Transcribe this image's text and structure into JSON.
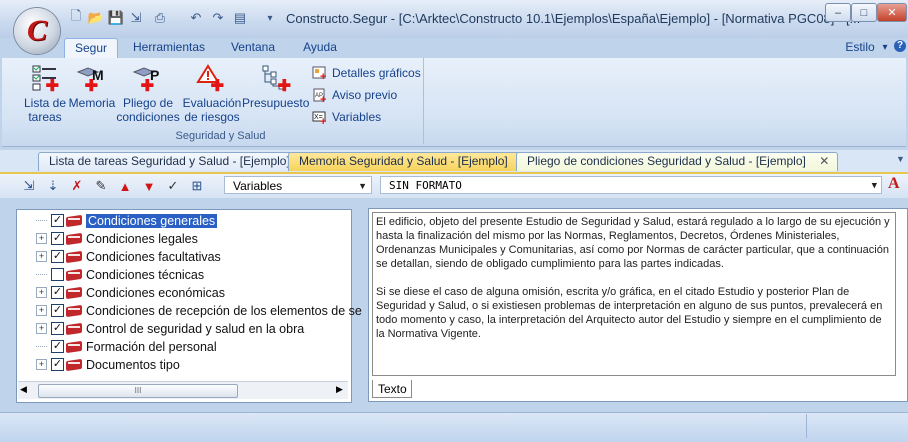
{
  "window": {
    "title": "Constructo.Segur - [C:\\Arktec\\Constructo 10.1\\Ejemplos\\España\\Ejemplo] - [Normativa PGC08] - [...",
    "app_logo": "C",
    "minimize": "‒",
    "maximize": "□",
    "close": "✕"
  },
  "ribbon_tabs": [
    "Segur",
    "Herramientas",
    "Ventana",
    "Ayuda"
  ],
  "estilo": {
    "label": "Estilo",
    "arrow": "▾"
  },
  "ribbon": {
    "buttons": [
      {
        "label_l1": "Lista de",
        "label_l2": "tareas",
        "icon": "task-list-icon"
      },
      {
        "label_l1": "Memoria",
        "label_l2": "",
        "icon": "memoria-icon"
      },
      {
        "label_l1": "Pliego de",
        "label_l2": "condiciones",
        "icon": "pliego-icon"
      },
      {
        "label_l1": "Evaluación",
        "label_l2": "de riesgos",
        "icon": "warning-icon"
      },
      {
        "label_l1": "Presupuesto",
        "label_l2": "",
        "icon": "budget-icon"
      }
    ],
    "small_buttons": [
      "Detalles gráficos",
      "Aviso previo",
      "Variables"
    ],
    "group_label": "Seguridad y Salud"
  },
  "doc_tabs": [
    "Lista de tareas Seguridad y Salud - [Ejemplo]",
    "Memoria Seguridad y Salud - [Ejemplo]",
    "Pliego de condiciones Seguridad y Salud - [Ejemplo]"
  ],
  "toolbar": {
    "combo1": "Variables",
    "combo2": "SIN FORMATO",
    "font_color_glyph": "A"
  },
  "tree": [
    {
      "label": "Condiciones generales",
      "checked": true,
      "expandable": false,
      "selected": true
    },
    {
      "label": "Condiciones legales",
      "checked": true,
      "expandable": true
    },
    {
      "label": "Condiciones facultativas",
      "checked": true,
      "expandable": true
    },
    {
      "label": "Condiciones técnicas",
      "checked": false,
      "expandable": false
    },
    {
      "label": "Condiciones económicas",
      "checked": true,
      "expandable": true
    },
    {
      "label": "Condiciones de recepción de los elementos de se",
      "checked": true,
      "expandable": true
    },
    {
      "label": "Control de seguridad y salud en la obra",
      "checked": true,
      "expandable": true
    },
    {
      "label": "Formación del personal",
      "checked": true,
      "expandable": false
    },
    {
      "label": "Documentos tipo",
      "checked": true,
      "expandable": true
    }
  ],
  "editor": {
    "paragraph1": "El edificio, objeto del presente Estudio de Seguridad y Salud, estará regulado a lo largo de su ejecución y hasta la finalización del mismo por las Normas, Reglamentos, Decretos, Órdenes Ministeriales, Ordenanzas Municipales y Comunitarias, así como por Normas de carácter particular, que a continuación se detallan, siendo de obligado cumplimiento para las partes indicadas.",
    "paragraph2": "Si se diese el caso de alguna omisión, escrita y/o gráfica, en el citado Estudio y posterior Plan de Seguridad y Salud, o si existiesen problemas de interpretación en alguno de sus puntos, prevalecerá en todo momento y caso, la interpretación del Arquitecto autor del Estudio y siempre en el cumplimiento de la Normativa Vigente.",
    "tab_label": "Texto"
  },
  "scrollbar": {
    "thumb_glyph": "III"
  }
}
